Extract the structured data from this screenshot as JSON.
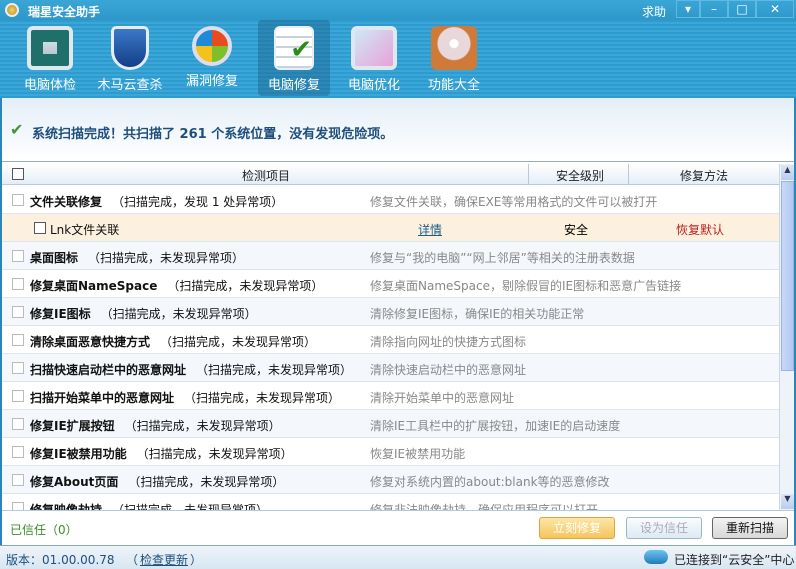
{
  "app": {
    "title": "瑞星安全助手",
    "help": "求助"
  },
  "toolbar": [
    {
      "label": "电脑体检",
      "icon": "monitor-pulse-icon"
    },
    {
      "label": "木马云查杀",
      "icon": "shield-icon"
    },
    {
      "label": "漏洞修复",
      "icon": "windows-update-icon"
    },
    {
      "label": "电脑修复",
      "icon": "checklist-icon",
      "active": true
    },
    {
      "label": "电脑优化",
      "icon": "magic-wand-monitor-icon"
    },
    {
      "label": "功能大全",
      "icon": "disc-box-icon"
    }
  ],
  "status": {
    "message": "系统扫描完成！共扫描了 261 个系统位置，没有发现危险项。",
    "scanned_count": 261
  },
  "table": {
    "headers": {
      "item": "检测项目",
      "level": "安全级别",
      "method": "修复方法"
    },
    "rows": [
      {
        "name": "文件关联修复",
        "status": "（扫描完成，发现 1 处异常项）",
        "desc": "修复文件关联，确保EXE等常用格式的文件可以被打开"
      },
      {
        "sub": true,
        "name": "Lnk文件关联",
        "detail": "详情",
        "level": "安全",
        "method": "恢复默认"
      },
      {
        "name": "桌面图标",
        "status": "（扫描完成，未发现异常项）",
        "desc": "修复与“我的电脑”“网上邻居”等相关的注册表数据"
      },
      {
        "name": "修复桌面NameSpace",
        "status": "（扫描完成，未发现异常项）",
        "desc": "修复桌面NameSpace，剔除假冒的IE图标和恶意广告链接"
      },
      {
        "name": "修复IE图标",
        "status": "（扫描完成，未发现异常项）",
        "desc": "清除修复IE图标，确保IE的相关功能正常"
      },
      {
        "name": "清除桌面恶意快捷方式",
        "status": "（扫描完成，未发现异常项）",
        "desc": "清除指向网址的快捷方式图标"
      },
      {
        "name": "扫描快速启动栏中的恶意网址",
        "status": "（扫描完成，未发现异常项）",
        "desc": "清除快速启动栏中的恶意网址"
      },
      {
        "name": "扫描开始菜单中的恶意网址",
        "status": "（扫描完成，未发现异常项）",
        "desc": "清除开始菜单中的恶意网址"
      },
      {
        "name": "修复IE扩展按钮",
        "status": "（扫描完成，未发现异常项）",
        "desc": "清除IE工具栏中的扩展按钮，加速IE的启动速度"
      },
      {
        "name": "修复IE被禁用功能",
        "status": "（扫描完成，未发现异常项）",
        "desc": "恢复IE被禁用功能"
      },
      {
        "name": "修复About页面",
        "status": "（扫描完成，未发现异常项）",
        "desc": "修复对系统内置的about:blank等的恶意修改"
      },
      {
        "name": "修复映像劫持",
        "status": "（扫描完成，未发现异常项）",
        "desc": "修复非法映像劫持，确保应用程序可以打开"
      }
    ]
  },
  "footer": {
    "trusted": "已信任（0）",
    "fix_now": "立刻修复",
    "set_trusted": "设为信任",
    "rescan": "重新扫描"
  },
  "bottom": {
    "version": "版本：01.00.00.78",
    "check_update": "检查更新",
    "paren_open": "（",
    "paren_close": "）",
    "connection": "已连接到“云安全”中心"
  }
}
